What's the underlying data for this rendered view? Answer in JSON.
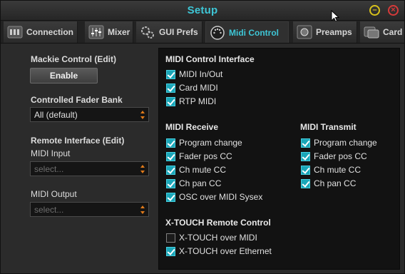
{
  "window": {
    "title": "Setup"
  },
  "tabs": [
    {
      "label": "Connection",
      "icon": "connection-icon"
    },
    {
      "label": "Mixer",
      "icon": "mixer-icon"
    },
    {
      "label": "GUI Prefs",
      "icon": "gears-icon"
    },
    {
      "label": "Midi Control",
      "icon": "midi-icon",
      "active": true
    },
    {
      "label": "Preamps",
      "icon": "preamp-icon"
    },
    {
      "label": "Card",
      "icon": "card-icon"
    }
  ],
  "left": {
    "mackie_label": "Mackie Control (Edit)",
    "enable_button": "Enable",
    "fader_bank_label": "Controlled Fader Bank",
    "fader_bank_value": "All (default)",
    "remote_label": "Remote Interface (Edit)",
    "midi_input_label": "MIDI Input",
    "midi_input_placeholder": "select...",
    "midi_output_label": "MIDI Output",
    "midi_output_placeholder": "select..."
  },
  "interface": {
    "title": "MIDI Control Interface",
    "items": [
      {
        "label": "MIDI In/Out",
        "checked": true
      },
      {
        "label": "Card MIDI",
        "checked": true
      },
      {
        "label": "RTP MIDI",
        "checked": true
      }
    ]
  },
  "receive": {
    "title": "MIDI Receive",
    "items": [
      {
        "label": "Program change",
        "checked": true
      },
      {
        "label": "Fader pos CC",
        "checked": true
      },
      {
        "label": "Ch mute CC",
        "checked": true
      },
      {
        "label": "Ch pan CC",
        "checked": true
      },
      {
        "label": "OSC over MIDI Sysex",
        "checked": true
      }
    ]
  },
  "transmit": {
    "title": "MIDI Transmit",
    "items": [
      {
        "label": "Program change",
        "checked": true
      },
      {
        "label": "Fader pos CC",
        "checked": true
      },
      {
        "label": "Ch mute CC",
        "checked": true
      },
      {
        "label": "Ch pan CC",
        "checked": true
      }
    ]
  },
  "xtouch": {
    "title": "X-TOUCH Remote Control",
    "items": [
      {
        "label": "X-TOUCH over MIDI",
        "checked": false
      },
      {
        "label": "X-TOUCH over Ethernet",
        "checked": true
      }
    ]
  },
  "colors": {
    "accent": "#3ec6d6",
    "checkbox": "#1aa6b8",
    "minimize": "#d8c21a",
    "close": "#d63a3a"
  }
}
